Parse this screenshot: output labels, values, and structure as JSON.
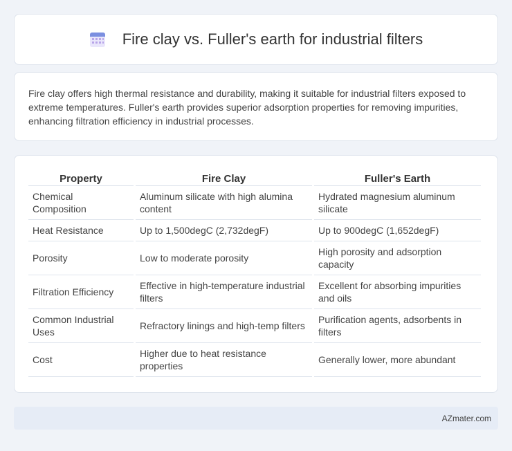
{
  "header": {
    "title": "Fire clay vs. Fuller's earth for industrial filters",
    "icon": "calendar-icon"
  },
  "summary": {
    "text": "Fire clay offers high thermal resistance and durability, making it suitable for industrial filters exposed to extreme temperatures. Fuller's earth provides superior adsorption properties for removing impurities, enhancing filtration efficiency in industrial processes."
  },
  "table": {
    "headers": [
      "Property",
      "Fire Clay",
      "Fuller's Earth"
    ],
    "rows": [
      [
        "Chemical Composition",
        "Aluminum silicate with high alumina content",
        "Hydrated magnesium aluminum silicate"
      ],
      [
        "Heat Resistance",
        "Up to 1,500degC (2,732degF)",
        "Up to 900degC (1,652degF)"
      ],
      [
        "Porosity",
        "Low to moderate porosity",
        "High porosity and adsorption capacity"
      ],
      [
        "Filtration Efficiency",
        "Effective in high-temperature industrial filters",
        "Excellent for absorbing impurities and oils"
      ],
      [
        "Common Industrial Uses",
        "Refractory linings and high-temp filters",
        "Purification agents, adsorbents in filters"
      ],
      [
        "Cost",
        "Higher due to heat resistance properties",
        "Generally lower, more abundant"
      ]
    ]
  },
  "footer": {
    "brand": "AZmater.com"
  },
  "colors": {
    "background": "#f0f3f8",
    "card": "#ffffff",
    "footer": "#e6ecf6",
    "icon_accent": "#8a7cd8"
  }
}
